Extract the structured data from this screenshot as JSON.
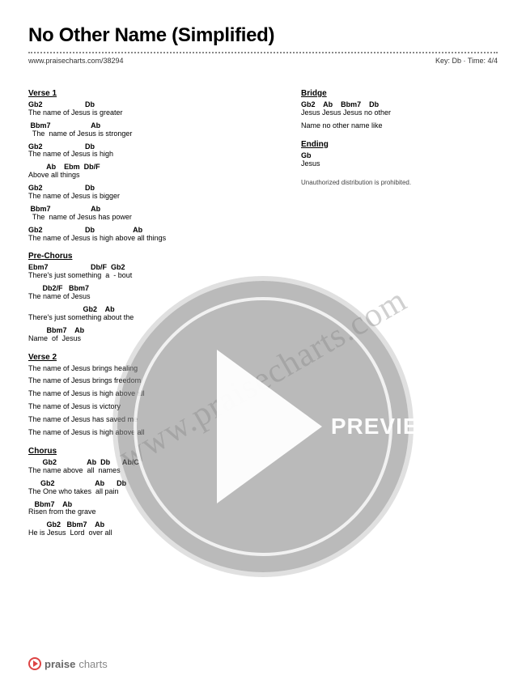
{
  "title": "No Other Name (Simplified)",
  "source_url": "www.praisecharts.com/38294",
  "key_time": "Key: Db · Time: 4/4",
  "watermark": "www.praisecharts.com",
  "preview_label": "PREVIEW",
  "footer_brand_bold": "praise",
  "footer_brand_light": "charts",
  "copyright_note": "Unauthorized distribution is prohibited.",
  "left_sections": [
    {
      "title": "Verse 1",
      "lines": [
        {
          "chords": "Gb2                     Db",
          "lyrics": "The name of Jesus is greater"
        },
        {
          "chords": " Bbm7                    Ab",
          "lyrics": "  The  name of Jesus is stronger"
        },
        {
          "chords": "Gb2                     Db",
          "lyrics": "The name of Jesus is high"
        },
        {
          "chords": "         Ab    Ebm  Db/F",
          "lyrics": "Above all things"
        },
        {
          "chords": "Gb2                     Db",
          "lyrics": "The name of Jesus is bigger"
        },
        {
          "chords": " Bbm7                    Ab",
          "lyrics": "  The  name of Jesus has power"
        },
        {
          "chords": "Gb2                     Db                   Ab",
          "lyrics": "The name of Jesus is high above all things"
        }
      ]
    },
    {
      "title": "Pre-Chorus",
      "lines": [
        {
          "chords": "Ebm7                     Db/F  Gb2",
          "lyrics": "There's just something  a  - bout"
        },
        {
          "chords": "       Db2/F   Bbm7",
          "lyrics": "The name of Jesus"
        },
        {
          "chords": "                           Gb2    Ab",
          "lyrics": "There's just something about the"
        },
        {
          "chords": "         Bbm7    Ab",
          "lyrics": "Name  of  Jesus"
        }
      ]
    },
    {
      "title": "Verse 2",
      "lines": [
        {
          "chords": "",
          "lyrics": "The name of Jesus brings healing"
        },
        {
          "chords": "",
          "lyrics": "The name of Jesus brings freedom"
        },
        {
          "chords": "",
          "lyrics": "The name of Jesus is high above all"
        },
        {
          "chords": "",
          "lyrics": "The name of Jesus is victory"
        },
        {
          "chords": "",
          "lyrics": "The name of Jesus has saved me"
        },
        {
          "chords": "",
          "lyrics": "The name of Jesus is high above all"
        }
      ]
    },
    {
      "title": "Chorus",
      "lines": [
        {
          "chords": "       Gb2               Ab  Db      Ab/C",
          "lyrics": "The name above  all  names"
        },
        {
          "chords": "      Gb2                    Ab      Db",
          "lyrics": "The One who takes  all pain"
        },
        {
          "chords": "   Bbm7    Ab",
          "lyrics": "Risen from the grave"
        },
        {
          "chords": "         Gb2   Bbm7    Ab",
          "lyrics": "He is Jesus  Lord  over all"
        }
      ]
    }
  ],
  "right_sections": [
    {
      "title": "Bridge",
      "lines": [
        {
          "chords": "Gb2    Ab    Bbm7    Db",
          "lyrics": "Jesus Jesus Jesus no other"
        },
        {
          "chords": "",
          "lyrics": "Name no other name like"
        }
      ]
    },
    {
      "title": "Ending",
      "lines": [
        {
          "chords": "Gb",
          "lyrics": "Jesus"
        }
      ]
    }
  ]
}
